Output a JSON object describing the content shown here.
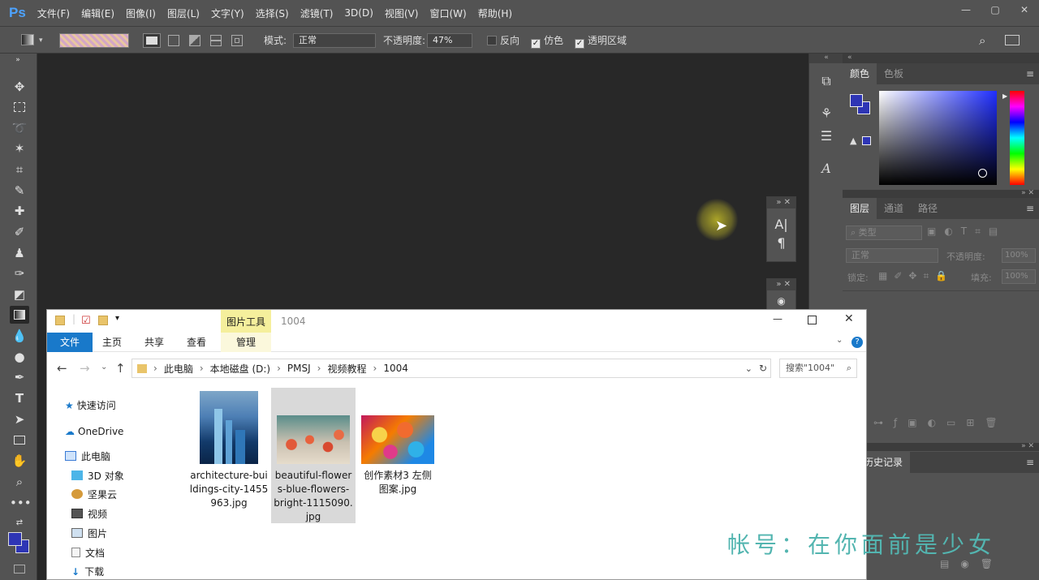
{
  "app": {
    "logo": "Ps"
  },
  "menu": [
    "文件(F)",
    "编辑(E)",
    "图像(I)",
    "图层(L)",
    "文字(Y)",
    "选择(S)",
    "滤镜(T)",
    "3D(D)",
    "视图(V)",
    "窗口(W)",
    "帮助(H)"
  ],
  "window_controls": {
    "minimize": "—",
    "restore": "▢",
    "close": "✕"
  },
  "options": {
    "mode_label": "模式:",
    "mode_value": "正常",
    "opacity_label": "不透明度:",
    "opacity_value": "47%",
    "reverse_label": "反向",
    "dither_label": "仿色",
    "transparency_label": "透明区域",
    "reverse_checked": false,
    "dither_checked": true,
    "transparency_checked": true
  },
  "color_panel": {
    "tabs": [
      "颜色",
      "色板"
    ],
    "foreground": "#2e35b5",
    "background": "#ffffff"
  },
  "layers_panel": {
    "tabs": [
      "图层",
      "通道",
      "路径"
    ],
    "search_placeholder": "类型",
    "blend_mode": "正常",
    "opacity_label": "不透明度:",
    "opacity_value": "100%",
    "lock_label": "锁定:",
    "fill_label": "填充:",
    "fill_value": "100%"
  },
  "history_panel": {
    "tab": "历史记录"
  },
  "explorer": {
    "title": "1004",
    "picture_tools": "图片工具",
    "ribbon_tabs": [
      "文件",
      "主页",
      "共享",
      "查看",
      "管理"
    ],
    "breadcrumb": [
      "此电脑",
      "本地磁盘 (D:)",
      "PMSJ",
      "视频教程",
      "1004"
    ],
    "search_placeholder": "搜索\"1004\"",
    "nav_items": [
      "快速访问",
      "OneDrive",
      "此电脑",
      "3D 对象",
      "坚果云",
      "视频",
      "图片",
      "文档",
      "下载"
    ],
    "files": [
      {
        "name": "architecture-buildings-city-1455963.jpg",
        "lines": [
          "architecture-bui",
          "ldings-city-1455",
          "963.jpg"
        ]
      },
      {
        "name": "beautiful-flowers-blue-flowers-bright-1115090.jpg",
        "lines": [
          "beautiful-flower",
          "s-blue-flowers-",
          "bright-1115090.",
          "jpg"
        ],
        "selected": true
      },
      {
        "name": "创作素材3 左侧图案.jpg",
        "lines": [
          "创作素材3 左侧",
          "图案.jpg"
        ]
      }
    ]
  },
  "watermark": "帐号：在你面前是少女"
}
